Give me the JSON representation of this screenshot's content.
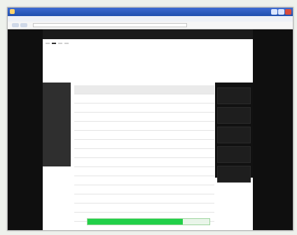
{
  "browser": {
    "title": "",
    "menus": [
      "",
      "",
      "",
      "",
      "",
      ""
    ],
    "address": "",
    "toolbar_right": ""
  },
  "site": {
    "tabs": [
      "",
      "",
      "",
      "",
      "",
      "",
      ""
    ],
    "breadcrumbs": [
      {
        "label": "",
        "active": false
      },
      {
        "label": "",
        "active": true
      },
      {
        "label": "",
        "active": false
      },
      {
        "label": "",
        "active": false
      }
    ],
    "hero": {
      "title": "",
      "subtitle": "",
      "line1": "",
      "line2": ""
    },
    "left_nav": [
      "",
      "",
      "",
      "",
      "",
      ""
    ],
    "right_cards": [
      "",
      "",
      "",
      "",
      ""
    ],
    "table": {
      "headers": [
        "",
        "",
        ""
      ],
      "rows": [
        [
          "",
          "",
          ""
        ],
        [
          "",
          "",
          ""
        ],
        [
          "",
          "",
          ""
        ],
        [
          "",
          "",
          ""
        ],
        [
          "",
          "",
          ""
        ],
        [
          "",
          "",
          ""
        ],
        [
          "",
          "",
          ""
        ],
        [
          "",
          "",
          ""
        ],
        [
          "",
          "",
          ""
        ],
        [
          "",
          "",
          ""
        ],
        [
          "",
          "",
          ""
        ],
        [
          "",
          "",
          ""
        ],
        [
          "",
          "",
          ""
        ],
        [
          "",
          "",
          ""
        ],
        [
          "",
          "",
          ""
        ],
        [
          "",
          "",
          ""
        ]
      ]
    },
    "progress": {
      "value": 0.78,
      "label": ""
    },
    "footer": ""
  },
  "statusbar": {
    "text": ""
  }
}
